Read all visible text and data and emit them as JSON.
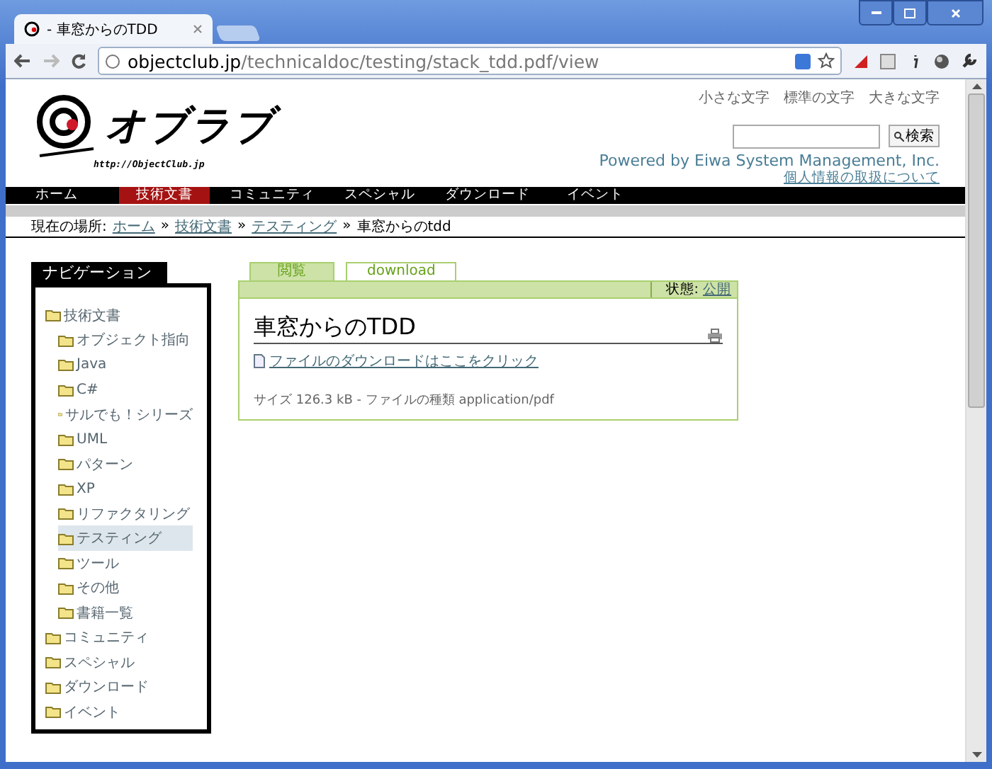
{
  "browser": {
    "tab_title": "- 車窓からのTDD",
    "url_host": "objectclub.jp",
    "url_path": "/technicaldoc/testing/stack_tdd.pdf/view"
  },
  "font_size_links": [
    "小さな文字",
    "標準の文字",
    "大きな文字"
  ],
  "logo": {
    "text": "オブラブ",
    "url": "http://ObjectClub.jp"
  },
  "search": {
    "button": "検索"
  },
  "powered_by": "Powered by Eiwa System Management, Inc.",
  "privacy_link": "個人情報の取扱について",
  "menu": [
    {
      "label": "ホーム",
      "selected": false
    },
    {
      "label": "技術文書",
      "selected": true
    },
    {
      "label": "コミュニティ",
      "selected": false
    },
    {
      "label": "スペシャル",
      "selected": false
    },
    {
      "label": "ダウンロード",
      "selected": false
    },
    {
      "label": "イベント",
      "selected": false
    }
  ],
  "breadcrumb": {
    "label": "現在の場所:",
    "links": [
      "ホーム",
      "技術文書",
      "テスティング"
    ],
    "separator": "»",
    "current": "車窓からのtdd"
  },
  "navigation": {
    "title": "ナビゲーション",
    "items": [
      {
        "label": "技術文書",
        "selected": false,
        "children": [
          {
            "label": "オブジェクト指向",
            "selected": false
          },
          {
            "label": "Java",
            "selected": false
          },
          {
            "label": "C#",
            "selected": false
          },
          {
            "label": "サルでも！シリーズ",
            "selected": false
          },
          {
            "label": "UML",
            "selected": false
          },
          {
            "label": "パターン",
            "selected": false
          },
          {
            "label": "XP",
            "selected": false
          },
          {
            "label": "リファクタリング",
            "selected": false
          },
          {
            "label": "テスティング",
            "selected": true
          },
          {
            "label": "ツール",
            "selected": false
          },
          {
            "label": "その他",
            "selected": false
          },
          {
            "label": "書籍一覧",
            "selected": false
          }
        ]
      },
      {
        "label": "コミュニティ",
        "selected": false
      },
      {
        "label": "スペシャル",
        "selected": false
      },
      {
        "label": "ダウンロード",
        "selected": false
      },
      {
        "label": "イベント",
        "selected": false
      }
    ]
  },
  "content": {
    "tabs": [
      {
        "label": "閲覧",
        "selected": true
      },
      {
        "label": "download",
        "selected": false
      }
    ],
    "state_label": "状態:",
    "state_value": "公開",
    "title": "車窓からのTDD",
    "download_link": "ファイルのダウンロードはここをクリック",
    "file_info": "サイズ 126.3 kB - ファイルの種類 application/pdf"
  }
}
